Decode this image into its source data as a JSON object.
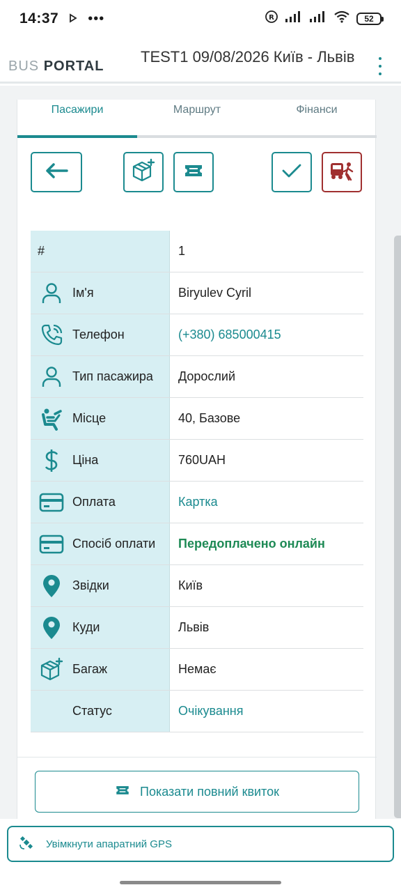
{
  "statusbar": {
    "time": "14:37",
    "battery": "52"
  },
  "header": {
    "logo_part1": "BUS",
    "logo_part2": "PORTAL",
    "title": "TEST1 09/08/2026 Київ - Львів"
  },
  "tabs": [
    {
      "label": "Пасажири",
      "active": true
    },
    {
      "label": "Маршрут",
      "active": false
    },
    {
      "label": "Фінанси",
      "active": false
    }
  ],
  "passenger": {
    "rows": [
      {
        "label": "#",
        "value": "1",
        "icon": "none"
      },
      {
        "label": "Ім'я",
        "value": "Biryulev Cyril",
        "icon": "person-icon"
      },
      {
        "label": "Телефон",
        "value": "(+380) 685000415",
        "icon": "phone-icon"
      },
      {
        "label": "Тип пасажира",
        "value": "Дорослий",
        "icon": "person-icon"
      },
      {
        "label": "Місце",
        "value": "40, Базове",
        "icon": "seat-icon"
      },
      {
        "label": "Ціна",
        "value": "760UAH",
        "icon": "dollar-icon"
      },
      {
        "label": "Оплата",
        "value": "Картка",
        "icon": "card-icon"
      },
      {
        "label": "Спосіб оплати",
        "value": "Передоплачено онлайн",
        "icon": "card-icon"
      },
      {
        "label": "Звідки",
        "value": "Київ",
        "icon": "location-icon"
      },
      {
        "label": "Куди",
        "value": "Львів",
        "icon": "location-icon"
      },
      {
        "label": "Багаж",
        "value": "Немає",
        "icon": "luggage-add-icon"
      },
      {
        "label": "Статус",
        "value": "Очікування",
        "icon": "none"
      }
    ]
  },
  "actions": {
    "full_ticket_label": "Показати повний квиток",
    "gps_label": "Увімкнути апаратний GPS"
  },
  "colors": {
    "accent": "#1b8a8f",
    "label_bg": "#d7eff3",
    "danger": "#a03030",
    "success": "#1e8a55"
  }
}
